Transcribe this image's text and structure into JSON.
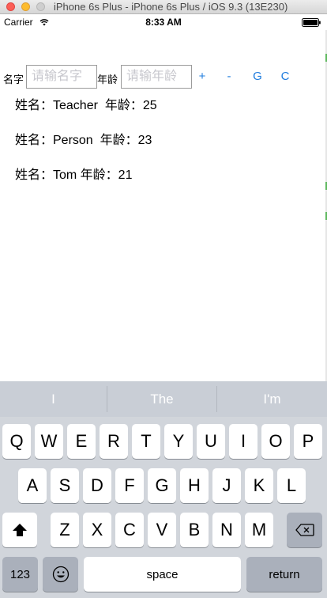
{
  "window": {
    "title": "iPhone 6s Plus - iPhone 6s Plus / iOS 9.3 (13E230)"
  },
  "status_bar": {
    "carrier": "Carrier",
    "time": "8:33 AM",
    "wifi_icon": "wifi-icon",
    "battery_icon": "battery-icon"
  },
  "form": {
    "name_label": "名字",
    "name_placeholder": "请输名字",
    "age_label": "年龄",
    "age_placeholder": "请输年龄",
    "buttons": {
      "add": "+",
      "remove": "-",
      "g": "G",
      "c": "C"
    },
    "accent_color": "#1f7cde"
  },
  "people": [
    {
      "text": "姓名：Teacher  年龄：25"
    },
    {
      "text": "姓名：Person  年龄：23"
    },
    {
      "text": "姓名：Tom 年龄：21"
    }
  ],
  "keyboard": {
    "suggestions": [
      "I",
      "The",
      "I'm"
    ],
    "row1": [
      "Q",
      "W",
      "E",
      "R",
      "T",
      "Y",
      "U",
      "I",
      "O",
      "P"
    ],
    "row2": [
      "A",
      "S",
      "D",
      "F",
      "G",
      "H",
      "J",
      "K",
      "L"
    ],
    "row3": [
      "Z",
      "X",
      "C",
      "V",
      "B",
      "N",
      "M"
    ],
    "shift_icon": "shift-icon",
    "delete_icon": "delete-icon",
    "emoji_icon": "emoji-icon",
    "numbers_label": "123",
    "space_label": "space",
    "return_label": "return"
  }
}
